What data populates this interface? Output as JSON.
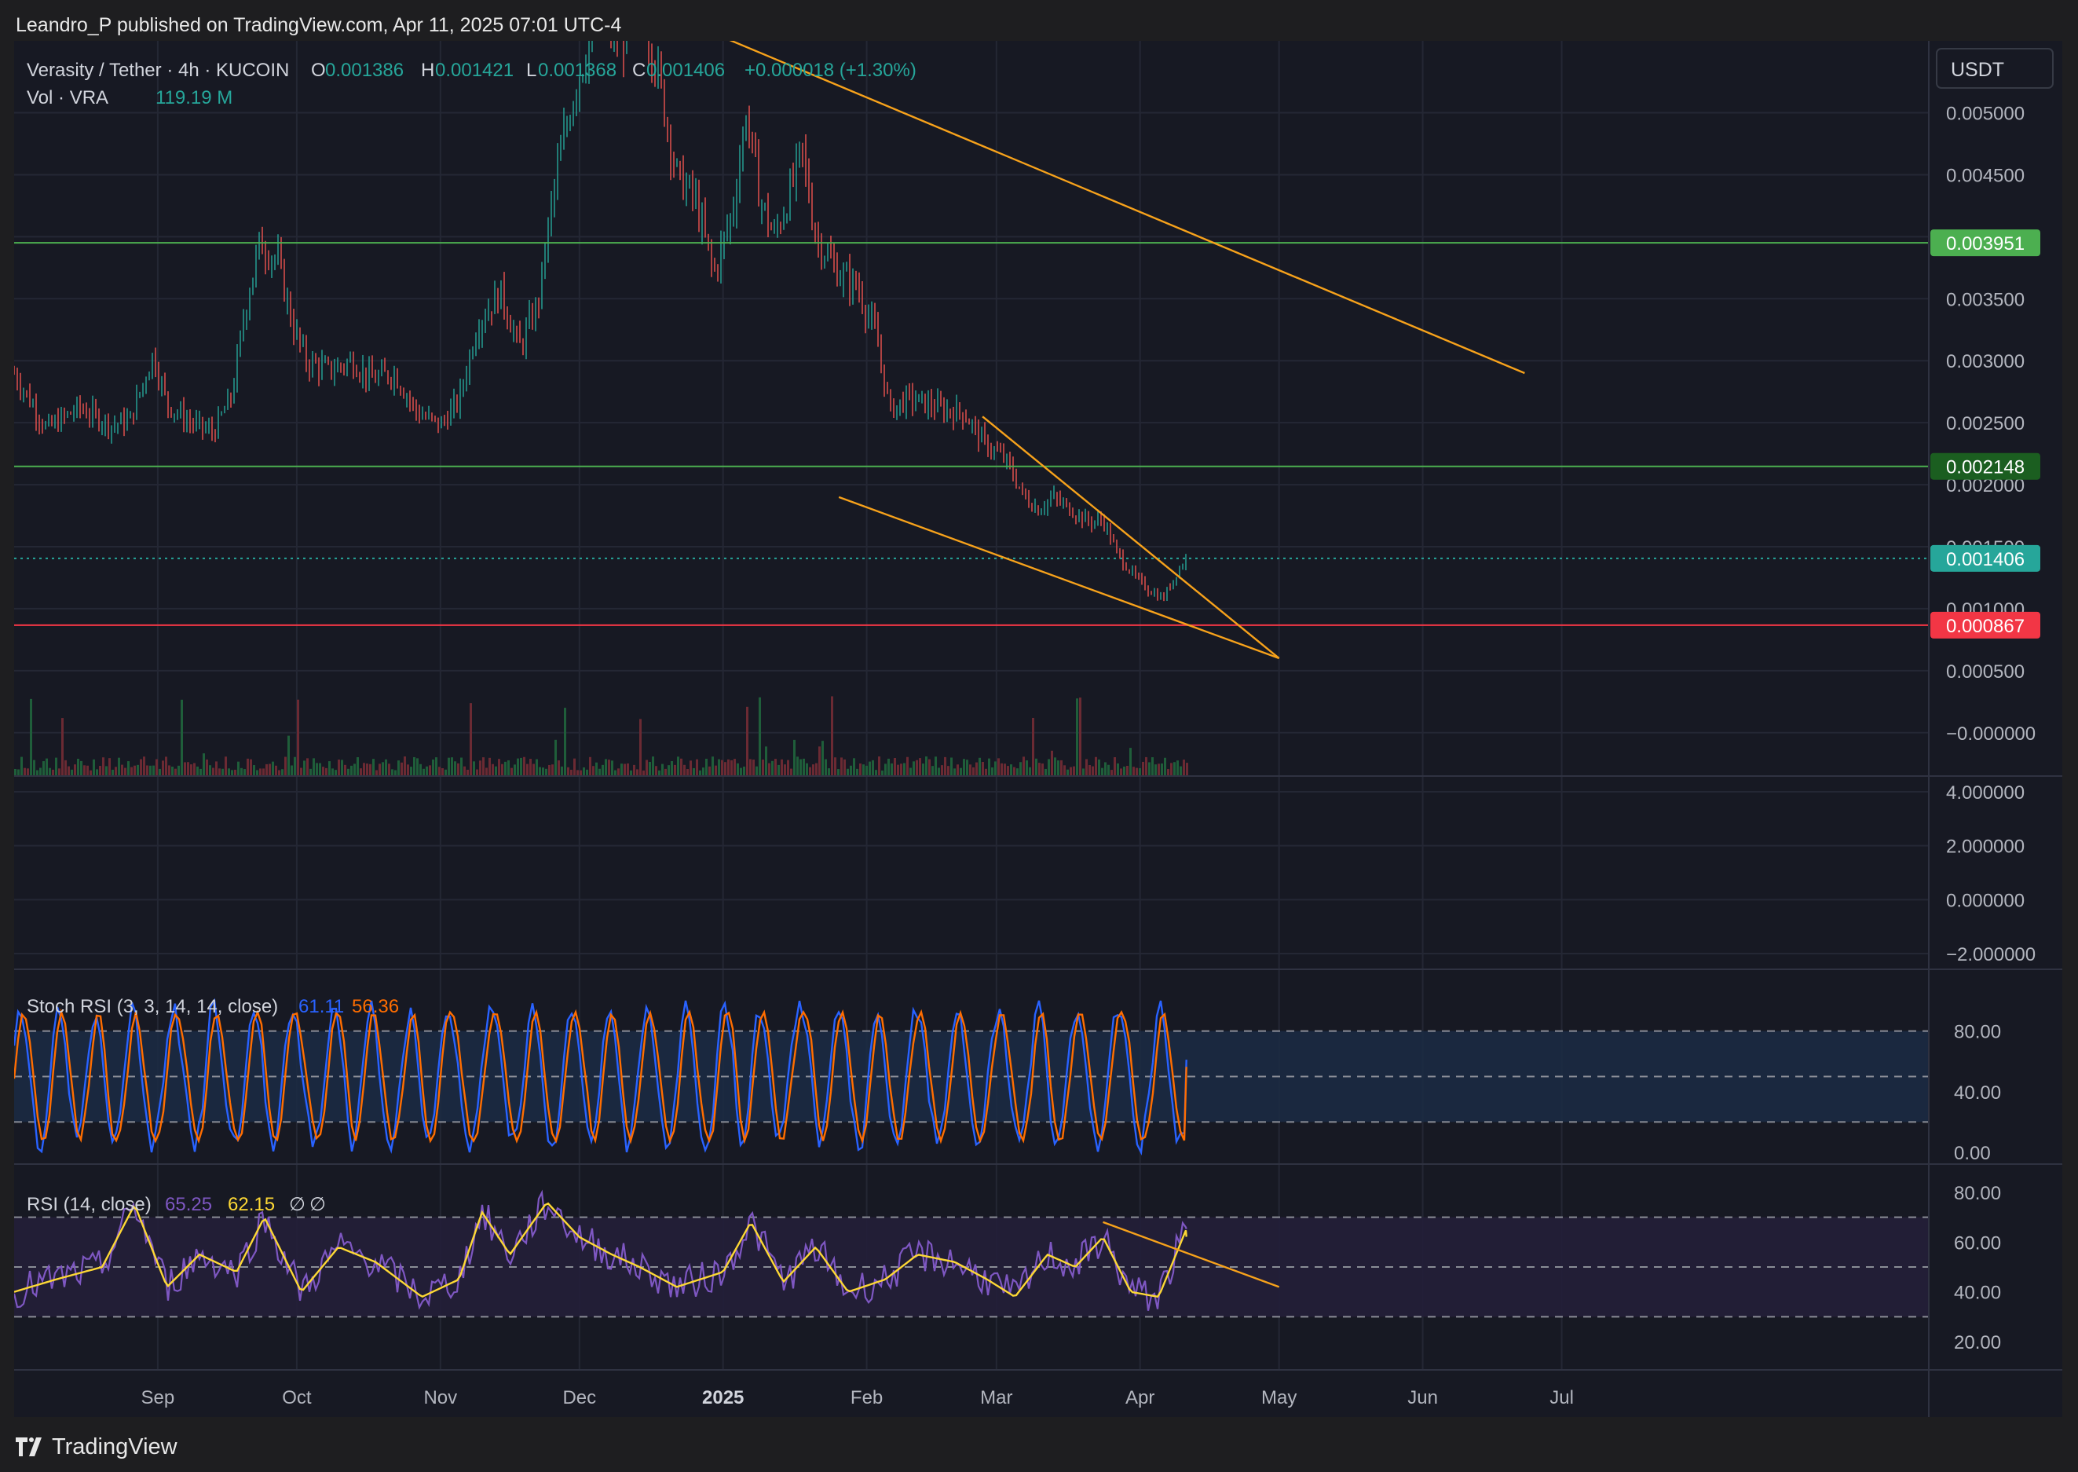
{
  "header": {
    "text": "Leandro_P published on TradingView.com, Apr 11, 2025 07:01 UTC-4"
  },
  "footer": {
    "brand": "TradingView"
  },
  "symbol": {
    "name": "Verasity / Tether · 4h · KUCOIN",
    "o_label": "O",
    "o": "0.001386",
    "h_label": "H",
    "h": "0.001421",
    "l_label": "L",
    "l": "0.001368",
    "c_label": "C",
    "c": "0.001406",
    "change": "+0.000018 (+1.30%)"
  },
  "volume": {
    "label": "Vol · VRA",
    "value": "119.19 M"
  },
  "currency": "USDT",
  "colors": {
    "bg": "#171923",
    "grid": "#242734",
    "up": "#26a69a",
    "down": "#ef5350",
    "text": "#b2b5be",
    "trendline": "#f7a21b",
    "support": "#4caf50",
    "resistance_label": "#4caf50",
    "mid_label": "#1b5e20",
    "last_price": "#26a69a",
    "red_line": "#f23645",
    "stoch_k": "#2962ff",
    "stoch_d": "#ff6d00",
    "rsi": "#7e57c2",
    "rsi_ma": "#fdd835"
  },
  "stoch": {
    "label": "Stoch RSI (3, 3, 14, 14, close)",
    "k": "61.11",
    "d": "56.36"
  },
  "rsi": {
    "label": "RSI (14, close)",
    "value": "65.25",
    "ma": "62.15",
    "extra1": "∅",
    "extra2": "∅"
  },
  "chart_data": [
    {
      "type": "line",
      "title": "Verasity / Tether · 4h · KUCOIN",
      "x_labels": [
        "Sep",
        "Oct",
        "Nov",
        "Dec",
        "2025",
        "Feb",
        "Mar",
        "Apr",
        "May",
        "Jun",
        "Jul"
      ],
      "y_ticks": [
        "0.005000",
        "0.004500",
        "0.003500",
        "0.003000",
        "0.002500",
        "0.002000",
        "0.001500",
        "0.001000",
        "0.000500",
        "−0.000000"
      ],
      "ylim": [
        -0.00035,
        0.00558
      ],
      "price_path": [
        [
          "2024-08-01",
          0.0029
        ],
        [
          "2024-08-08",
          0.00245
        ],
        [
          "2024-08-15",
          0.00262
        ],
        [
          "2024-08-22",
          0.00248
        ],
        [
          "2024-08-26",
          0.00252
        ],
        [
          "2024-08-31",
          0.00305
        ],
        [
          "2024-09-03",
          0.00265
        ],
        [
          "2024-09-08",
          0.0025
        ],
        [
          "2024-09-13",
          0.00242
        ],
        [
          "2024-09-17",
          0.00272
        ],
        [
          "2024-09-20",
          0.00345
        ],
        [
          "2024-09-23",
          0.00395
        ],
        [
          "2024-09-27",
          0.0038
        ],
        [
          "2024-09-30",
          0.0033
        ],
        [
          "2024-10-03",
          0.003
        ],
        [
          "2024-10-08",
          0.00292
        ],
        [
          "2024-10-13",
          0.003
        ],
        [
          "2024-10-17",
          0.00285
        ],
        [
          "2024-10-22",
          0.0029
        ],
        [
          "2024-10-27",
          0.00258
        ],
        [
          "2024-11-01",
          0.00248
        ],
        [
          "2024-11-05",
          0.00268
        ],
        [
          "2024-11-09",
          0.0033
        ],
        [
          "2024-11-14",
          0.00355
        ],
        [
          "2024-11-18",
          0.0031
        ],
        [
          "2024-11-22",
          0.00345
        ],
        [
          "2024-11-24",
          0.004
        ],
        [
          "2024-11-26",
          0.0045
        ],
        [
          "2024-11-30",
          0.0052
        ],
        [
          "2024-12-05",
          0.0058
        ],
        [
          "2024-12-10",
          0.0056
        ],
        [
          "2024-12-15",
          0.0058
        ],
        [
          "2024-12-18",
          0.0053
        ],
        [
          "2024-12-22",
          0.0045
        ],
        [
          "2024-12-26",
          0.0043
        ],
        [
          "2024-12-30",
          0.0037
        ],
        [
          "2025-01-03",
          0.0042
        ],
        [
          "2025-01-06",
          0.005
        ],
        [
          "2025-01-09",
          0.0043
        ],
        [
          "2025-01-12",
          0.004
        ],
        [
          "2025-01-15",
          0.0043
        ],
        [
          "2025-01-18",
          0.0047
        ],
        [
          "2025-01-21",
          0.004
        ],
        [
          "2025-01-26",
          0.0037
        ],
        [
          "2025-01-30",
          0.0036
        ],
        [
          "2025-02-03",
          0.0032
        ],
        [
          "2025-02-06",
          0.0026
        ],
        [
          "2025-02-10",
          0.0027
        ],
        [
          "2025-02-14",
          0.00265
        ],
        [
          "2025-02-18",
          0.0026
        ],
        [
          "2025-02-22",
          0.00258
        ],
        [
          "2025-02-26",
          0.00235
        ],
        [
          "2025-03-03",
          0.0022
        ],
        [
          "2025-03-07",
          0.0019
        ],
        [
          "2025-03-10",
          0.0018
        ],
        [
          "2025-03-13",
          0.0019
        ],
        [
          "2025-03-17",
          0.0018
        ],
        [
          "2025-03-21",
          0.0017
        ],
        [
          "2025-03-24",
          0.00172
        ],
        [
          "2025-03-27",
          0.00145
        ],
        [
          "2025-03-31",
          0.00125
        ],
        [
          "2025-04-03",
          0.00115
        ],
        [
          "2025-04-06",
          0.00108
        ],
        [
          "2025-04-09",
          0.0013
        ],
        [
          "2025-04-11",
          0.001406
        ]
      ],
      "horizontal_levels": [
        {
          "value": "0.003951",
          "price": 0.003951,
          "role": "resistance"
        },
        {
          "value": "0.002148",
          "price": 0.002148,
          "role": "support"
        },
        {
          "value": "0.001406",
          "price": 0.001406,
          "role": "last"
        },
        {
          "value": "0.000867",
          "price": 0.000867,
          "role": "stop"
        }
      ],
      "trendlines": [
        {
          "from": [
            "2024-12-23",
            0.00575
          ],
          "to": [
            "2025-06-23",
            0.0029
          ]
        },
        {
          "from": [
            "2025-02-26",
            0.00255
          ],
          "to": [
            "2025-05-01",
            0.0006
          ]
        },
        {
          "from": [
            "2025-01-26",
            0.0019
          ],
          "to": [
            "2025-05-01",
            0.0006
          ]
        }
      ],
      "volume": {
        "label": "Vol · VRA",
        "last": "119.19 M"
      }
    },
    {
      "type": "line",
      "title": "",
      "y_ticks": [
        "4.000000",
        "2.000000",
        "0.000000",
        "−2.000000"
      ],
      "ylim": [
        -2.0,
        4.0
      ]
    },
    {
      "type": "line",
      "title": "Stoch RSI (3, 3, 14, 14, close)",
      "series": [
        {
          "name": "K",
          "last": 61.11
        },
        {
          "name": "D",
          "last": 56.36
        }
      ],
      "y_ticks": [
        "80.00",
        "40.00",
        "0.00"
      ],
      "bands": [
        20,
        50,
        80
      ],
      "ylim": [
        0,
        100
      ]
    },
    {
      "type": "line",
      "title": "RSI (14, close)",
      "series": [
        {
          "name": "RSI",
          "last": 65.25
        },
        {
          "name": "MA",
          "last": 62.15
        }
      ],
      "y_ticks": [
        "80.00",
        "60.00",
        "40.00",
        "20.00"
      ],
      "bands": [
        30,
        50,
        70
      ],
      "ylim": [
        15,
        85
      ],
      "rsi_path": [
        [
          "2024-08-01",
          40
        ],
        [
          "2024-08-10",
          45
        ],
        [
          "2024-08-20",
          50
        ],
        [
          "2024-08-27",
          75
        ],
        [
          "2024-09-03",
          42
        ],
        [
          "2024-09-10",
          55
        ],
        [
          "2024-09-18",
          48
        ],
        [
          "2024-09-24",
          70
        ],
        [
          "2024-10-02",
          40
        ],
        [
          "2024-10-10",
          58
        ],
        [
          "2024-10-18",
          52
        ],
        [
          "2024-10-28",
          38
        ],
        [
          "2024-11-05",
          45
        ],
        [
          "2024-11-10",
          72
        ],
        [
          "2024-11-16",
          55
        ],
        [
          "2024-11-24",
          76
        ],
        [
          "2024-12-01",
          62
        ],
        [
          "2024-12-08",
          55
        ],
        [
          "2024-12-14",
          50
        ],
        [
          "2024-12-22",
          42
        ],
        [
          "2025-01-01",
          48
        ],
        [
          "2025-01-07",
          68
        ],
        [
          "2025-01-14",
          44
        ],
        [
          "2025-01-21",
          58
        ],
        [
          "2025-01-28",
          40
        ],
        [
          "2025-02-05",
          45
        ],
        [
          "2025-02-12",
          55
        ],
        [
          "2025-02-20",
          52
        ],
        [
          "2025-02-27",
          45
        ],
        [
          "2025-03-05",
          38
        ],
        [
          "2025-03-12",
          55
        ],
        [
          "2025-03-18",
          50
        ],
        [
          "2025-03-24",
          62
        ],
        [
          "2025-03-30",
          40
        ],
        [
          "2025-04-05",
          38
        ],
        [
          "2025-04-11",
          65.25
        ]
      ],
      "trendline": {
        "from": [
          "2025-03-24",
          68
        ],
        "to": [
          "2025-05-01",
          42
        ]
      }
    }
  ]
}
